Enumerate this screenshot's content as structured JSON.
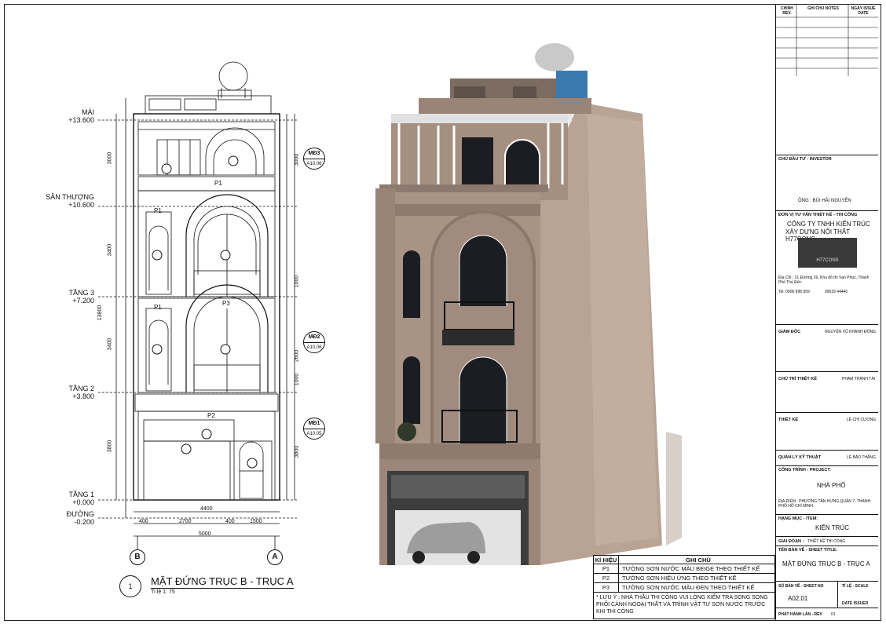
{
  "levels": [
    {
      "name": "MÁI",
      "value": "+13.600"
    },
    {
      "name": "SÂN THƯỢNG",
      "value": "+10.600"
    },
    {
      "name": "TẦNG 3",
      "value": "+7.200"
    },
    {
      "name": "TẦNG 2",
      "value": "+3.800"
    },
    {
      "name": "TẦNG 1",
      "value": "+0.000"
    },
    {
      "name": "ĐƯỜNG",
      "value": "-0.200"
    }
  ],
  "dims": {
    "left_vertical": [
      "3000",
      "3400",
      "3400",
      "3800"
    ],
    "left_inner": [
      "300",
      "2200",
      "400",
      "400",
      "2300",
      "400",
      "2300",
      "400",
      "2900",
      "400"
    ],
    "total": "13800",
    "bottom": [
      "400",
      "2700",
      "400",
      "1500",
      "400"
    ],
    "bottom_total": "5000",
    "top": "4400",
    "right": [
      "3000",
      "1000",
      "3400",
      "2600",
      "1000",
      "3800",
      "300"
    ]
  },
  "tags": [
    {
      "t": "MĐ3",
      "b": "A10.06"
    },
    {
      "t": "MĐ2",
      "b": "A10.06"
    },
    {
      "t": "MĐ1",
      "b": "A10.05"
    }
  ],
  "labels": {
    "p1": "P1",
    "p2": "P2",
    "p3": "P3"
  },
  "axes": [
    "B",
    "A"
  ],
  "title": {
    "number": "1",
    "name": "MẶT ĐỨNG TRỤC B - TRỤC A",
    "scale": "Tỉ lệ 1: 75"
  },
  "legend": {
    "col1": "KÍ HIỆU",
    "col2": "GHI CHÚ",
    "rows": [
      {
        "code": "P1",
        "text": "TƯỜNG SƠN NƯỚC MÀU BEIGE THEO THIẾT KẾ"
      },
      {
        "code": "P2",
        "text": "TƯỜNG SƠN HIỆU ỨNG THEO THIẾT KẾ"
      },
      {
        "code": "P3",
        "text": "TƯỜNG SƠN NƯỚC MÀU ĐEN THEO THIẾT KẾ"
      }
    ],
    "note": "* LƯU Ý : NHÀ THẦU THI CÔNG VUI LÒNG KIỂM TRA SONG SONG PHỐI CẢNH NGOẠI THẤT VÀ TRÌNH VẬT TƯ SƠN NƯỚC TRƯỚC KHI THI CÔNG"
  },
  "titleblock": {
    "rev": "CHỈNH REV.",
    "notes": "GHI CHÚ NOTES",
    "date": "NGÀY ISSUE DATE",
    "investor_label": "CHỦ ĐẦU TƯ - INVESTOR",
    "investor": "ÔNG : BÙI HẢI NGUYÊN",
    "designer_label": "ĐƠN VỊ TƯ VẤN THIẾT KẾ - THI CÔNG",
    "company1": "CÔNG TY TNHH KIẾN TRÚC",
    "company2": "XÂY DỰNG NỘI THẤT H77CONS",
    "logo": "H77CONS",
    "address": "Địa Chỉ : 21 Đường 26, Khu đô thị Vạn Phúc, Thành Phố Thủ Đức",
    "tel": "Tel: 0906 898 959",
    "tel2": "09029 44440",
    "director_label": "GIÁM ĐỐC",
    "director": "NGUYỄN VŨ KHÁNH ĐÔNG",
    "lead_label": "CHỦ TRÌ THIẾT KẾ",
    "lead": "PHẠM THÀNH TÀI",
    "design_label": "THIẾT KẾ",
    "design": "LÊ CHÍ CƯƠNG",
    "tech_label": "QUẢN LÝ KỸ THUẬT",
    "tech": "LÊ BẢO THẮNG",
    "project_label": "CÔNG TRÌNH - PROJECT:",
    "project": "NHÀ PHỐ",
    "location": "ĐỊA ĐIỂM : PHƯỜNG TÂN HƯNG,QUẬN 7, THÀNH PHỐ HỒ CHÍ MINH.",
    "item_label": "HẠNG MỤC - ITEM:",
    "item": "KIẾN TRÚC",
    "phase_label": "GIAI ĐOẠN :",
    "phase": "THIẾT KẾ THI CÔNG",
    "sheet_title_label": "TÊN BẢN VẼ - SHEET TITLE:",
    "sheet_title": "MẶT ĐỨNG TRỤC B - TRỤC A",
    "sheet_no_label": "SỐ BẢN VẼ - SHEET NO",
    "scale_label": "TỈ LỆ - SCALE",
    "sheet_no": "A02.01",
    "date_issued": "DATE ISSUED",
    "issue_label": "PHÁT HÀNH LẦN - REV",
    "issue": "01"
  },
  "colors": {
    "facade": "#a99385",
    "facade_dark": "#8f7a6e",
    "glass": "#1b1d22",
    "frame": "#ffffff",
    "logo_bg": "#3a3a3a"
  }
}
